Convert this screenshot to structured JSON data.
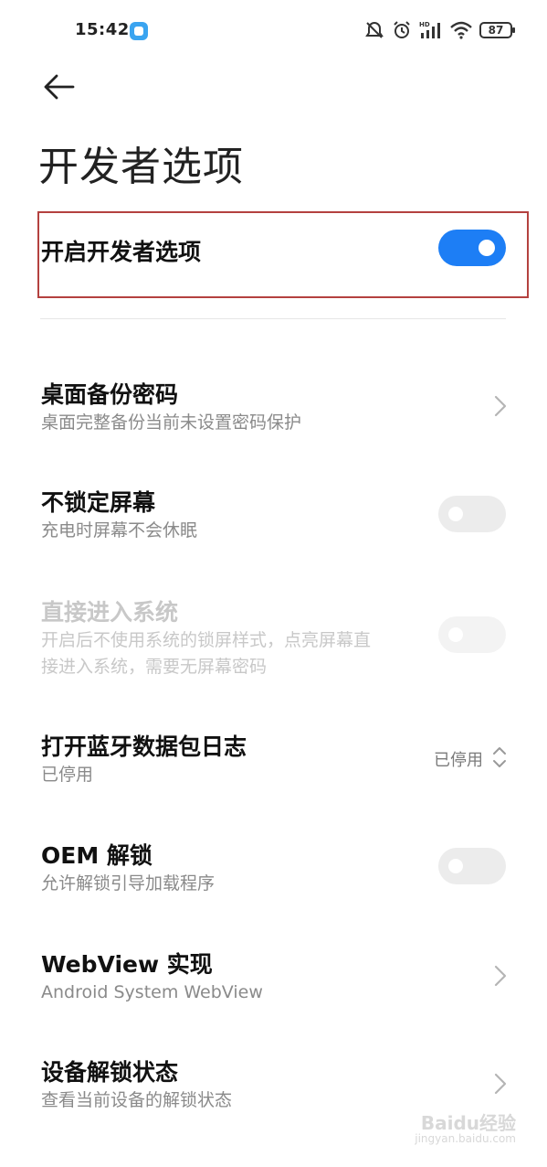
{
  "status_bar": {
    "time": "15:42",
    "battery": "87",
    "icons": [
      "mute-icon",
      "alarm-icon",
      "signal-hd-icon",
      "wifi-icon",
      "battery-icon"
    ]
  },
  "page": {
    "title": "开发者选项"
  },
  "master": {
    "label": "开启开发者选项",
    "enabled": true
  },
  "items": [
    {
      "title": "桌面备份密码",
      "subtitle": "桌面完整备份当前未设置密码保护",
      "control": "chevron"
    },
    {
      "title": "不锁定屏幕",
      "subtitle": "充电时屏幕不会休眠",
      "control": "toggle",
      "on": false
    },
    {
      "title": "直接进入系统",
      "subtitle_lines": [
        "开启后不使用系统的锁屏样式，点亮屏幕直",
        "接进入系统，需要无屏幕密码"
      ],
      "control": "toggle",
      "on": false,
      "disabled": true
    },
    {
      "title": "打开蓝牙数据包日志",
      "subtitle": "已停用",
      "control": "select",
      "value": "已停用"
    },
    {
      "title": "OEM 解锁",
      "subtitle": "允许解锁引导加载程序",
      "control": "toggle",
      "on": false
    },
    {
      "title": "WebView 实现",
      "subtitle": "Android System WebView",
      "control": "chevron"
    },
    {
      "title": "设备解锁状态",
      "subtitle": "查看当前设备的解锁状态",
      "control": "chevron"
    }
  ],
  "watermark": {
    "text": "Baidu经验",
    "sub": "jingyan.baidu.com"
  },
  "colors": {
    "accent": "#1d7ef5",
    "highlight_border": "#b4413f"
  }
}
